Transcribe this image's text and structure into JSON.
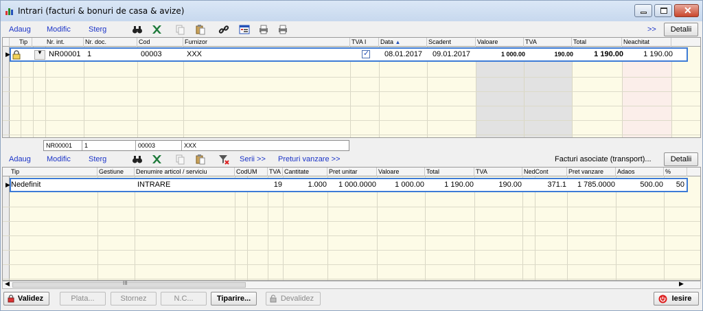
{
  "window": {
    "title": "Intrari (facturi & bonuri de casa & avize)"
  },
  "top_toolbar": {
    "links": [
      {
        "label": "Adaug",
        "key": "A"
      },
      {
        "label": "Modific",
        "key": "M"
      },
      {
        "label": "Sterg",
        "key": "S"
      }
    ],
    "more_label": ">>",
    "details_label": "Detalii"
  },
  "invoices_grid": {
    "columns": [
      "Tip",
      "Nr. int.",
      "Nr. doc.",
      "Cod",
      "Furnizor",
      "TVA I",
      "Data",
      "Scadent",
      "Valoare",
      "TVA",
      "Total",
      "Neachitat"
    ],
    "rows": [
      {
        "nr_int": "NR00001",
        "nr_doc": "1",
        "cod": "00003",
        "furnizor": "XXX",
        "tva_i": true,
        "data": "08.01.2017",
        "scadent": "09.01.2017",
        "valoare": "1 000.00",
        "tva": "190.00",
        "total": "1 190.00",
        "neachitat": "1 190.00"
      }
    ]
  },
  "summary": {
    "nr_int": "NR00001",
    "nr_doc": "1",
    "cod": "00003",
    "furnizor": "XXX"
  },
  "lines_toolbar": {
    "links": [
      {
        "label": "Adaug",
        "key": "A"
      },
      {
        "label": "Modific",
        "key": "M"
      },
      {
        "label": "Sterg",
        "key": "S"
      }
    ],
    "serii_label": "Serii >>",
    "preturi_label": "Preturi vanzare >>",
    "facturi_asociate_label": "Facturi asociate (transport)...",
    "details_label": "Detalii"
  },
  "lines_grid": {
    "columns": [
      "Tip",
      "Gestiune",
      "Denumire articol / serviciu",
      "CodUM",
      "TVA",
      "Cantitate",
      "Pret unitar",
      "Valoare",
      "Total",
      "TVA",
      "NedCont",
      "Pret vanzare",
      "Adaos",
      "%"
    ],
    "rows": [
      {
        "tip": "Nedefinit",
        "gestiune": "",
        "denumire": "INTRARE",
        "codum": "",
        "tva": "19",
        "cantitate": "1.000",
        "pret_unitar": "1 000.0000",
        "valoare": "1 000.00",
        "total": "1 190.00",
        "tva_val": "190.00",
        "cont": "371.1",
        "pret_vanzare": "1 785.0000",
        "adaos": "500.00",
        "procent": "50"
      }
    ]
  },
  "hscroll": {
    "thumb_glyph": "III"
  },
  "statusbar": {
    "valideaza_label": "Validez",
    "plata_label": "Plata...",
    "storneaza_label": "Stornez",
    "nc_label": "N.C...",
    "tipareste_label": "Tiparire...",
    "devalideaza_label": "Devalidez",
    "iesire_label": "Iesire"
  },
  "colors": {
    "grid_bg": "#fdfbe7",
    "link": "#1a33c7",
    "selection": "#3d7bd6",
    "gray_col": "#e2e2e2",
    "pink_col": "#fbeeea"
  }
}
